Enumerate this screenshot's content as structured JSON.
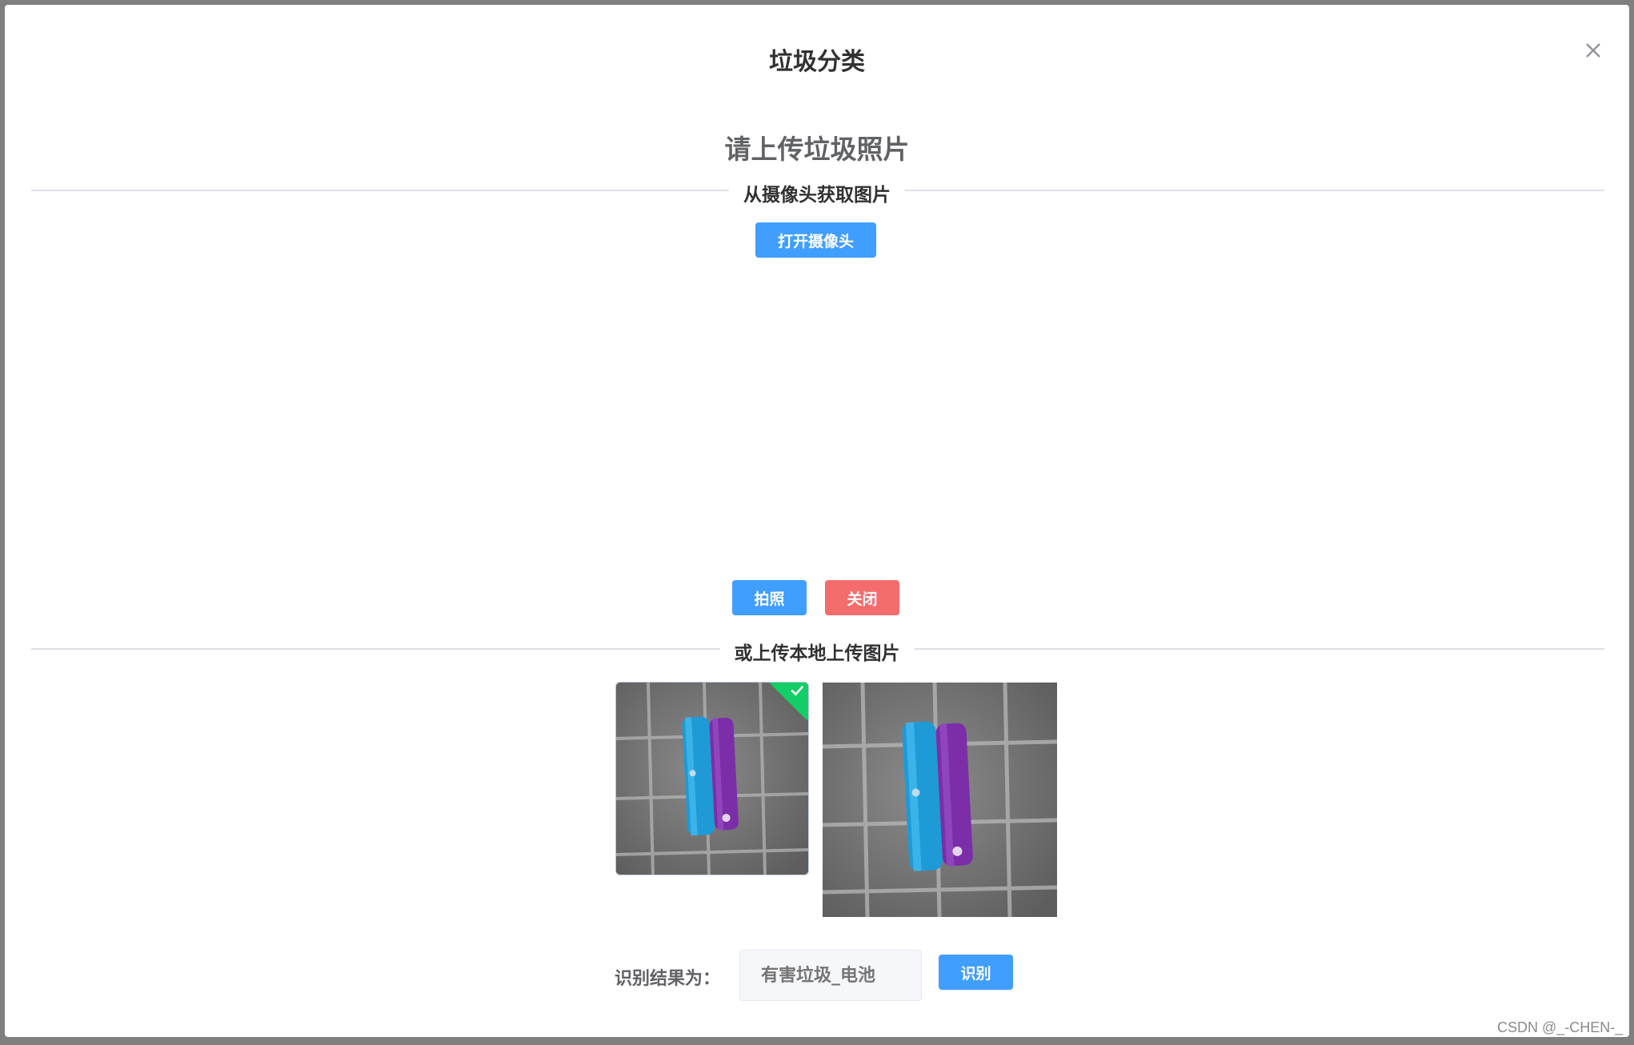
{
  "dialog": {
    "title": "垃圾分类"
  },
  "upload": {
    "heading": "请上传垃圾照片",
    "camera_section": "从摄像头获取图片",
    "open_camera_label": "打开摄像头",
    "capture_label": "拍照",
    "close_camera_label": "关闭",
    "local_section": "或上传本地上传图片"
  },
  "result": {
    "label": "识别结果为：",
    "placeholder": "有害垃圾_电池",
    "recognize_label": "识别"
  },
  "watermark": "CSDN @_-CHEN-_",
  "colors": {
    "primary": "#409eff",
    "danger": "#f56c6c",
    "success": "#13ce66"
  },
  "icons": {
    "close": "close-icon",
    "upload_success": "check-icon"
  }
}
